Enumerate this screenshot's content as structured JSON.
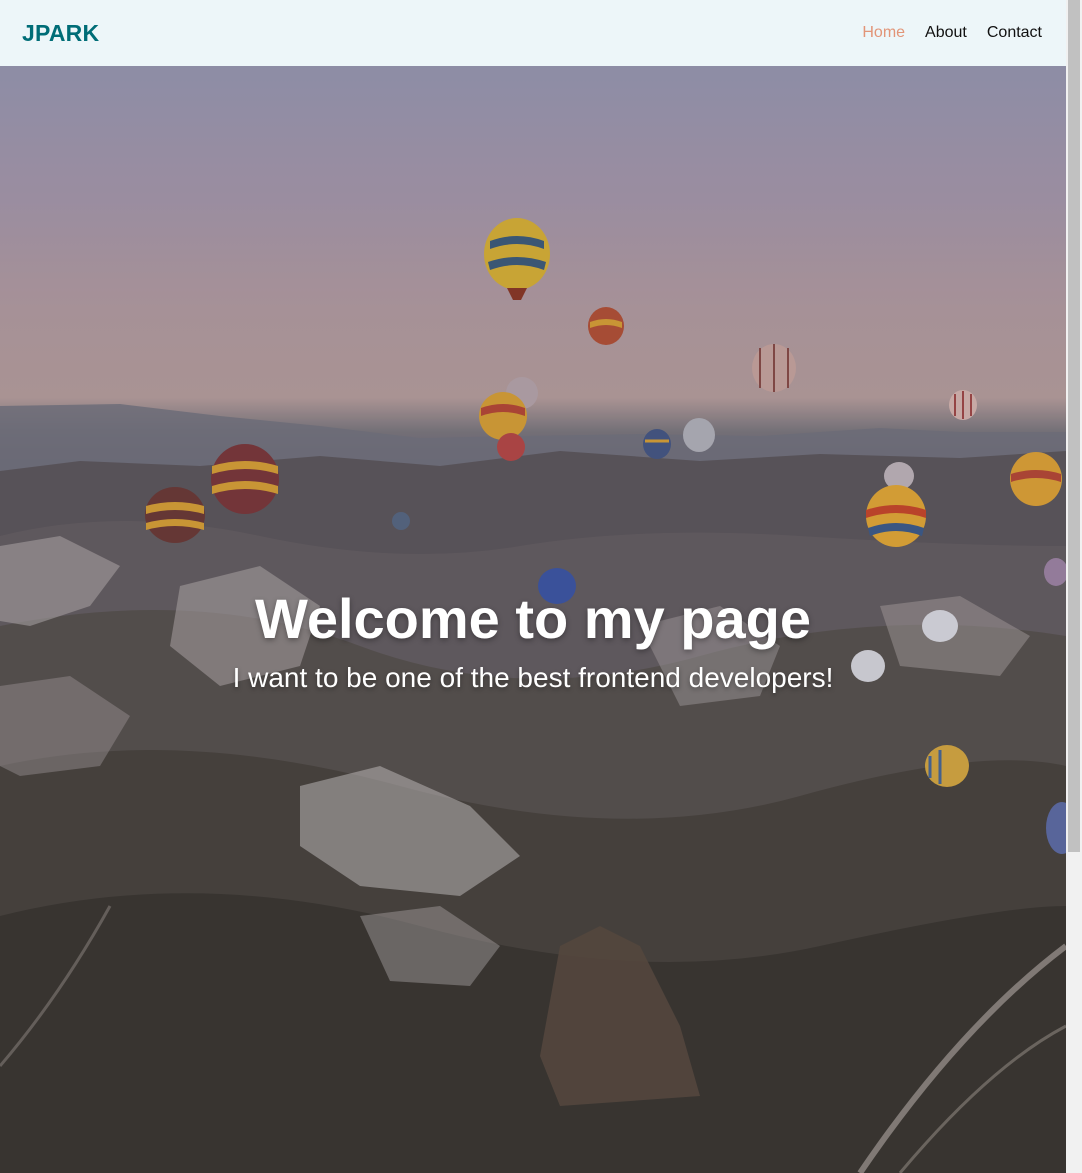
{
  "nav": {
    "logo": "JPARK",
    "items": [
      {
        "label": "Home",
        "active": true
      },
      {
        "label": "About",
        "active": false
      },
      {
        "label": "Contact",
        "active": false
      }
    ]
  },
  "hero": {
    "title": "Welcome to my page",
    "subtitle": "I want to be one of the best frontend developers!"
  },
  "colors": {
    "brand": "#006d77",
    "active_link": "#e29578",
    "nav_bg": "#edf6f9"
  }
}
